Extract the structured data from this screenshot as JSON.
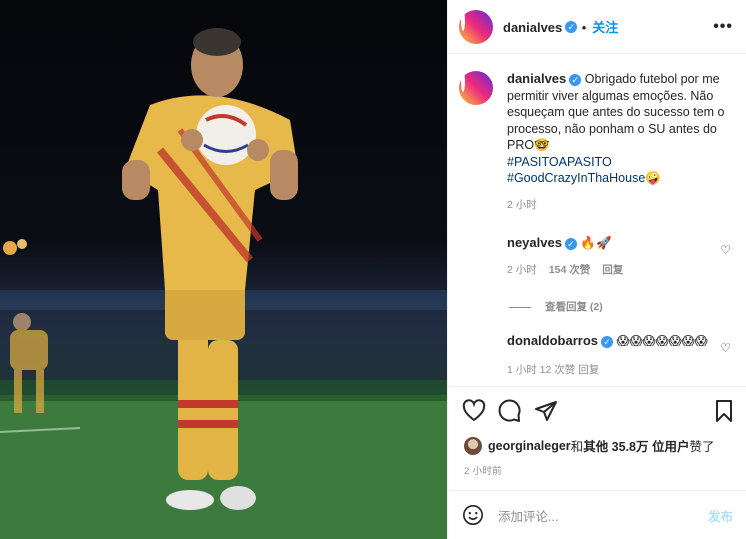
{
  "post": {
    "author": "danialves",
    "follow_label": "关注",
    "more_label": "•••",
    "verified_glyph": "✓"
  },
  "caption": {
    "username": "danialves",
    "text": "Obrigado futebol por me permitir viver algumas emoções. Não esqueçam que antes do sucesso tem o processo, não ponham o SU antes do PRO",
    "emoji_1": "🤓",
    "hashtag_1": "#PASITOAPASITO",
    "hashtag_2": "#GoodCrazyInThaHouse",
    "emoji_2": "🤪",
    "time": "2 小时"
  },
  "comments": [
    {
      "username": "neyalves",
      "text": "🔥🚀",
      "time": "2 小时",
      "likes": "154 次赞",
      "reply": "回复",
      "view_replies": "查看回复 (2)"
    },
    {
      "username": "donaldobarros",
      "text": "😱😱😱😱😱😱😱",
      "meta_partial": "1 小时   12 次赞   回复"
    }
  ],
  "likes_line": {
    "user": "georginaleger",
    "mid": " 和 ",
    "others": "其他 35.8万 位用户",
    "suffix": " 赞了"
  },
  "post_time": "2 小时前",
  "composer": {
    "placeholder": "添加评论...",
    "post_label": "发布"
  },
  "colors": {
    "link": "#0095f6",
    "hashtag": "#00376b",
    "muted": "#8e8e8e",
    "jersey": "#e8b84a",
    "stripe": "#c0392b"
  },
  "icons": [
    "heart-icon",
    "comment-icon",
    "share-icon",
    "save-icon",
    "emoji-icon"
  ]
}
